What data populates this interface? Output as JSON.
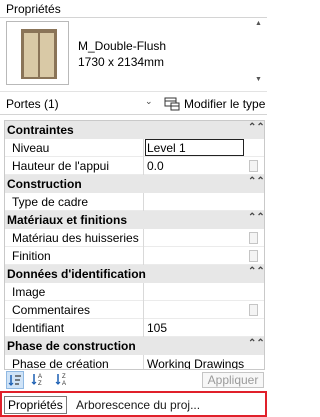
{
  "panel": {
    "title": "Propriétés"
  },
  "type_selector": {
    "family_type": "M_Double-Flush",
    "size": "1730 x 2134mm",
    "thumbnail_icon": "double-door-icon"
  },
  "filter": {
    "selected": "Portes (1)",
    "edit_type_label": "Modifier le type"
  },
  "properties": {
    "sections": [
      {
        "label": "Contraintes",
        "collapse_icon": "double-chevron-up-icon"
      },
      {
        "label": "Construction",
        "collapse_icon": "double-chevron-up-icon"
      },
      {
        "label": "Matériaux et finitions",
        "collapse_icon": "double-chevron-up-icon"
      },
      {
        "label": "Données d'identification",
        "collapse_icon": "double-chevron-up-icon"
      },
      {
        "label": "Phase de construction",
        "collapse_icon": "double-chevron-up-icon"
      }
    ],
    "params": [
      {
        "name": "Niveau",
        "value": "Level 1"
      },
      {
        "name": "Hauteur de l'appui",
        "value": "0.0"
      },
      {
        "name": "Type de cadre",
        "value": ""
      },
      {
        "name": "Matériau des huisseries",
        "value": ""
      },
      {
        "name": "Finition",
        "value": ""
      },
      {
        "name": "Image",
        "value": ""
      },
      {
        "name": "Commentaires",
        "value": ""
      },
      {
        "name": "Identifiant",
        "value": "105"
      },
      {
        "name": "Phase de création",
        "value": "Working Drawings"
      }
    ]
  },
  "footer": {
    "sort_icons": [
      "sort-categorized-icon",
      "sort-az-icon",
      "sort-za-icon"
    ],
    "apply_label": "Appliquer"
  },
  "tabs": [
    {
      "label": "Propriétés",
      "active": true
    },
    {
      "label": "Arborescence du proj...",
      "active": false
    }
  ],
  "colors": {
    "section_bg": "#e7e7e7",
    "tab_highlight": "#e0202a",
    "active_sort": "#cfe3f7"
  }
}
